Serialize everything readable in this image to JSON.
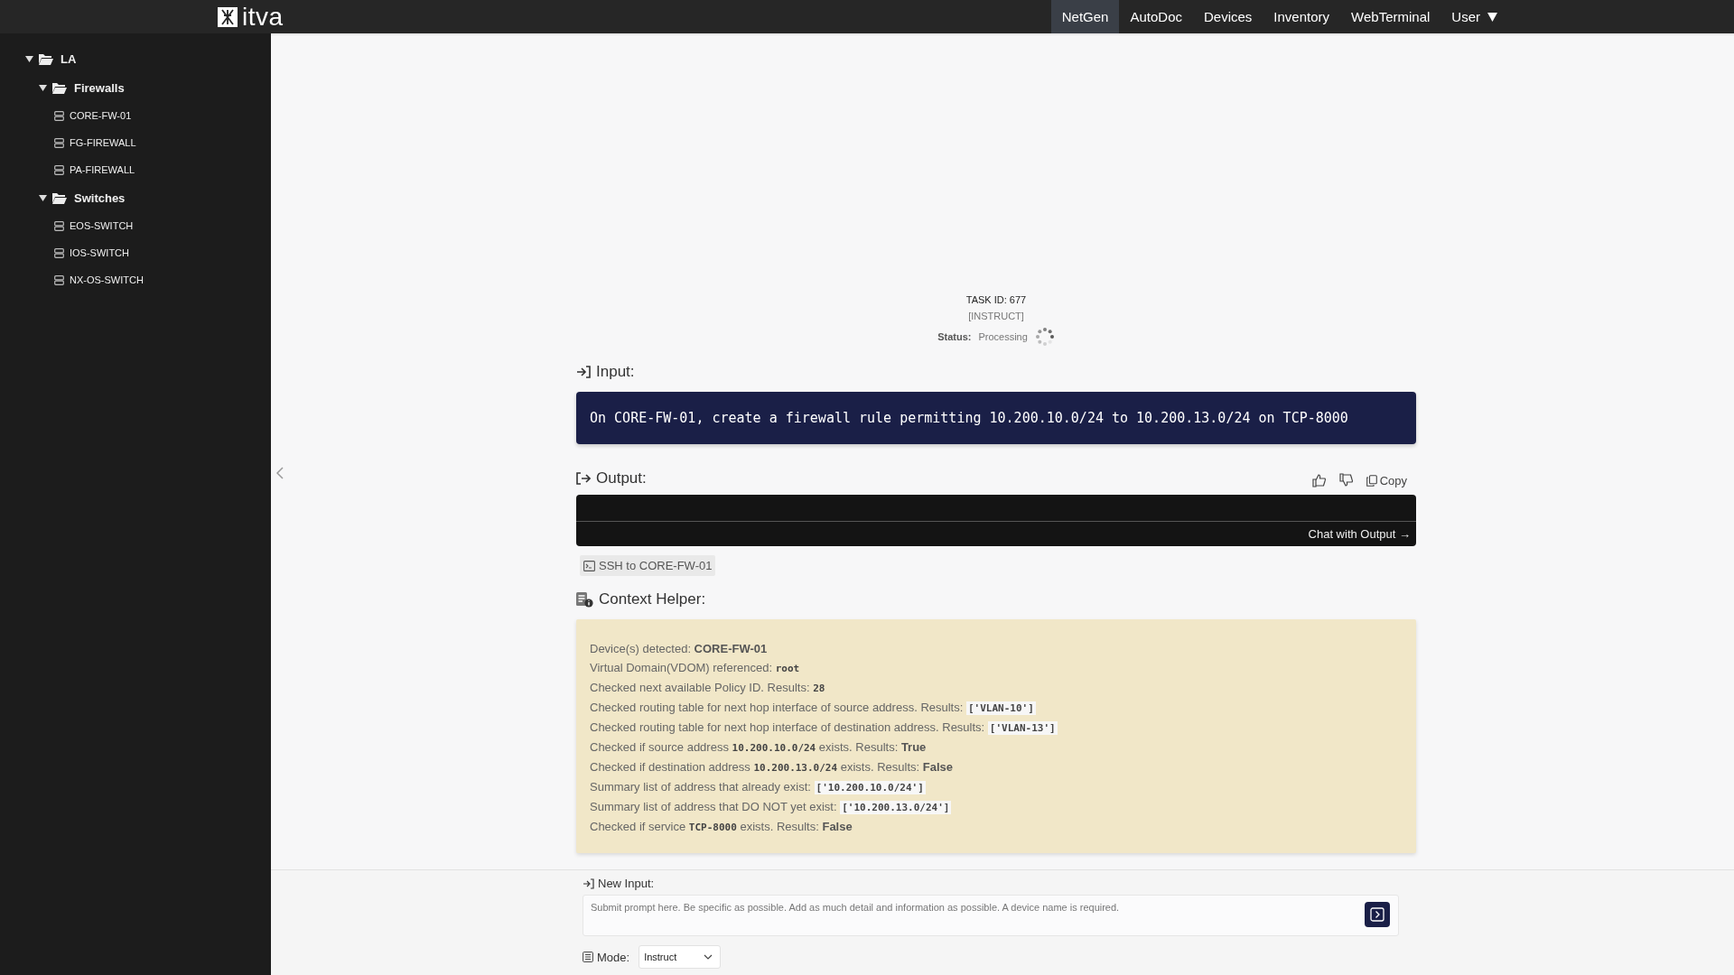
{
  "brand": {
    "name": "itva"
  },
  "nav": [
    {
      "label": "NetGen",
      "selected": true
    },
    {
      "label": "AutoDoc",
      "selected": false
    },
    {
      "label": "Devices",
      "selected": false
    },
    {
      "label": "Inventory",
      "selected": false
    },
    {
      "label": "WebTerminal",
      "selected": false
    },
    {
      "label": "User",
      "selected": false,
      "kind": "dropdown"
    }
  ],
  "sidebar": {
    "tree": [
      {
        "label": "LA",
        "kind": "folder",
        "expanded": true,
        "children": [
          {
            "label": "Firewalls",
            "kind": "folder",
            "expanded": true,
            "children": [
              {
                "label": "CORE-FW-01",
                "kind": "device"
              },
              {
                "label": "FG-FIREWALL",
                "kind": "device"
              },
              {
                "label": "PA-FIREWALL",
                "kind": "device"
              }
            ]
          },
          {
            "label": "Switches",
            "kind": "folder",
            "expanded": true,
            "children": [
              {
                "label": "EOS-SWITCH",
                "kind": "device"
              },
              {
                "label": "IOS-SWITCH",
                "kind": "device"
              },
              {
                "label": "NX-OS-SWITCH",
                "kind": "device"
              }
            ]
          }
        ]
      }
    ]
  },
  "task": {
    "id_label": "TASK ID: 677",
    "mode_tag": "[INSTRUCT]",
    "status_label": "Status:",
    "status": "Processing"
  },
  "input": {
    "heading": "Input:",
    "text": "On CORE-FW-01, create a firewall rule permitting 10.200.10.0/24 to 10.200.13.0/24 on TCP-8000"
  },
  "output": {
    "heading": "Output:",
    "copy_label": "Copy",
    "chat_link": "Chat with Output →"
  },
  "ssh_button": "SSH to CORE-FW-01",
  "context_helper": {
    "heading": "Context Helper:",
    "lines": [
      {
        "parts": [
          {
            "kind": "plain",
            "text": "Device(s) detected: "
          },
          {
            "kind": "bold",
            "text": "CORE-FW-01"
          }
        ]
      },
      {
        "parts": [
          {
            "kind": "plain",
            "text": "Virtual Domain(VDOM) referenced: "
          },
          {
            "kind": "code",
            "text": "root"
          }
        ]
      },
      {
        "parts": [
          {
            "kind": "plain",
            "text": "Checked next available Policy ID. Results: "
          },
          {
            "kind": "code",
            "text": "28"
          }
        ]
      },
      {
        "parts": [
          {
            "kind": "plain",
            "text": "Checked routing table for next hop interface of source address. Results: "
          },
          {
            "kind": "codebox",
            "text": "['VLAN-10']"
          }
        ]
      },
      {
        "parts": [
          {
            "kind": "plain",
            "text": "Checked routing table for next hop interface of destination address. Results: "
          },
          {
            "kind": "codebox",
            "text": "['VLAN-13']"
          }
        ]
      },
      {
        "parts": [
          {
            "kind": "plain",
            "text": "Checked if source address "
          },
          {
            "kind": "code",
            "text": "10.200.10.0/24"
          },
          {
            "kind": "plain",
            "text": " exists. Results: "
          },
          {
            "kind": "bold",
            "text": "True"
          }
        ]
      },
      {
        "parts": [
          {
            "kind": "plain",
            "text": "Checked if destination address "
          },
          {
            "kind": "code",
            "text": "10.200.13.0/24"
          },
          {
            "kind": "plain",
            "text": " exists. Results: "
          },
          {
            "kind": "bold",
            "text": "False"
          }
        ]
      },
      {
        "parts": [
          {
            "kind": "plain",
            "text": "Summary list of address that already exist: "
          },
          {
            "kind": "codebox",
            "text": "['10.200.10.0/24']"
          }
        ]
      },
      {
        "parts": [
          {
            "kind": "plain",
            "text": "Summary list of address that DO NOT yet exist: "
          },
          {
            "kind": "codebox",
            "text": "['10.200.13.0/24']"
          }
        ]
      },
      {
        "parts": [
          {
            "kind": "plain",
            "text": "Checked if service "
          },
          {
            "kind": "code",
            "text": "TCP-8000"
          },
          {
            "kind": "plain",
            "text": " exists. Results: "
          },
          {
            "kind": "bold",
            "text": "False"
          }
        ]
      }
    ]
  },
  "new_input": {
    "label": "New Input:",
    "placeholder": "Submit prompt here. Be specific as possible. Add as much detail and information as possible. A device name is required."
  },
  "mode": {
    "label": "Mode:",
    "value": "Instruct"
  }
}
